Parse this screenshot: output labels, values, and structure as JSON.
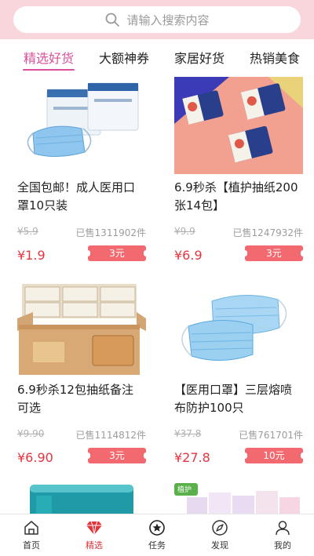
{
  "search": {
    "placeholder": "请输入搜索内容"
  },
  "tabs": [
    {
      "label": "精选好货",
      "active": true
    },
    {
      "label": "大额神券",
      "active": false
    },
    {
      "label": "家居好货",
      "active": false
    },
    {
      "label": "热销美食",
      "active": false
    }
  ],
  "products": [
    {
      "title": "全国包邮！成人医用口罩10只装",
      "original_price": "¥5.9",
      "sold": "已售1311902件",
      "price": "¥1.9",
      "coupon": "3元",
      "image": "mask-packs-image"
    },
    {
      "title": "6.9秒杀【植护抽纸200张14包】",
      "original_price": "¥9.9",
      "sold": "已售1247932件",
      "price": "¥6.9",
      "coupon": "3元",
      "image": "tissue-packs-image"
    },
    {
      "title": "6.9秒杀12包抽纸备注可选",
      "original_price": "¥9.90",
      "sold": "已售1114812件",
      "price": "¥6.90",
      "coupon": "3元",
      "image": "tissue-box-image"
    },
    {
      "title": "【医用口罩】三层熔喷布防护100只",
      "original_price": "¥37.8",
      "sold": "已售761701件",
      "price": "¥27.8",
      "coupon": "10元",
      "image": "surgical-masks-image"
    },
    {
      "image": "teal-container-image"
    },
    {
      "image": "tissue-stack-image",
      "tag": "植护"
    }
  ],
  "colors": {
    "accent": "#d9519a",
    "price": "#e5363f",
    "coupon": "#f26a6f",
    "header": "#f8d6dc"
  },
  "bottom_nav": [
    {
      "label": "首页",
      "icon": "home-icon",
      "active": false
    },
    {
      "label": "精选",
      "icon": "diamond-icon",
      "active": true
    },
    {
      "label": "任务",
      "icon": "star-icon",
      "active": false
    },
    {
      "label": "发现",
      "icon": "compass-icon",
      "active": false
    },
    {
      "label": "我的",
      "icon": "user-icon",
      "active": false
    }
  ]
}
